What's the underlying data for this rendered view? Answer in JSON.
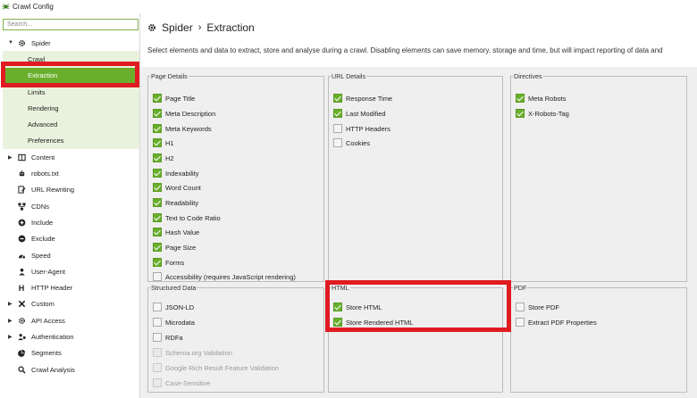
{
  "window": {
    "title": "Crawl Config"
  },
  "sidebar": {
    "search_placeholder": "Search...",
    "items": [
      {
        "label": "Spider",
        "icon": "gear-icon",
        "level": 1,
        "caret": "expanded"
      },
      {
        "label": "Crawl",
        "level": 2
      },
      {
        "label": "Extraction",
        "level": 2,
        "selected": true
      },
      {
        "label": "Limits",
        "level": 2
      },
      {
        "label": "Rendering",
        "level": 2
      },
      {
        "label": "Advanced",
        "level": 2
      },
      {
        "label": "Preferences",
        "level": 2,
        "highlight": true
      },
      {
        "label": "Content",
        "icon": "content-icon",
        "level": 1,
        "caret": "collapsed"
      },
      {
        "label": "robots.txt",
        "icon": "robot-icon",
        "level": 1
      },
      {
        "label": "URL Rewriting",
        "icon": "rewrite-icon",
        "level": 1
      },
      {
        "label": "CDNs",
        "icon": "cdn-icon",
        "level": 1
      },
      {
        "label": "Include",
        "icon": "include-icon",
        "level": 1
      },
      {
        "label": "Exclude",
        "icon": "exclude-icon",
        "level": 1
      },
      {
        "label": "Speed",
        "icon": "speed-icon",
        "level": 1
      },
      {
        "label": "User-Agent",
        "icon": "user-agent-icon",
        "level": 1
      },
      {
        "label": "HTTP Header",
        "icon": "http-header-icon",
        "level": 1
      },
      {
        "label": "Custom",
        "icon": "custom-icon",
        "level": 1,
        "caret": "collapsed"
      },
      {
        "label": "API Access",
        "icon": "api-icon",
        "level": 1,
        "caret": "collapsed"
      },
      {
        "label": "Authentication",
        "icon": "auth-icon",
        "level": 1,
        "caret": "collapsed"
      },
      {
        "label": "Segments",
        "icon": "segments-icon",
        "level": 1
      },
      {
        "label": "Crawl Analysis",
        "icon": "search-icon",
        "level": 1
      }
    ]
  },
  "main": {
    "breadcrumb": {
      "section": "Spider",
      "separator": "›",
      "page": "Extraction"
    },
    "description": "Select elements and data to extract, store and analyse during a crawl. Disabling elements can save memory, storage and time, but will impact reporting of data and",
    "groups": {
      "page_details": {
        "legend": "Page Details",
        "options": [
          {
            "label": "Page Title",
            "checked": true
          },
          {
            "label": "Meta Description",
            "checked": true
          },
          {
            "label": "Meta Keywords",
            "checked": true
          },
          {
            "label": "H1",
            "checked": true
          },
          {
            "label": "H2",
            "checked": true
          },
          {
            "label": "Indexability",
            "checked": true
          },
          {
            "label": "Word Count",
            "checked": true
          },
          {
            "label": "Readability",
            "checked": true
          },
          {
            "label": "Text to Code Ratio",
            "checked": true
          },
          {
            "label": "Hash Value",
            "checked": true
          },
          {
            "label": "Page Size",
            "checked": true
          },
          {
            "label": "Forms",
            "checked": true
          },
          {
            "label": "Accessibility (requires JavaScript rendering)",
            "checked": false
          }
        ]
      },
      "url_details": {
        "legend": "URL Details",
        "options": [
          {
            "label": "Response Time",
            "checked": true
          },
          {
            "label": "Last Modified",
            "checked": true
          },
          {
            "label": "HTTP Headers",
            "checked": false
          },
          {
            "label": "Cookies",
            "checked": false
          }
        ]
      },
      "directives": {
        "legend": "Directives",
        "options": [
          {
            "label": "Meta Robots",
            "checked": true
          },
          {
            "label": "X-Robots-Tag",
            "checked": true
          }
        ]
      },
      "structured_data": {
        "legend": "Structured Data",
        "options": [
          {
            "label": "JSON-LD",
            "checked": false
          },
          {
            "label": "Microdata",
            "checked": false
          },
          {
            "label": "RDFa",
            "checked": false
          },
          {
            "label": "Schema.org Validation",
            "checked": false,
            "disabled": true
          },
          {
            "label": "Google Rich Result Feature Validation",
            "checked": false,
            "disabled": true
          },
          {
            "label": "Case-Sensitive",
            "checked": false,
            "disabled": true
          }
        ]
      },
      "html": {
        "legend": "HTML",
        "options": [
          {
            "label": "Store HTML",
            "checked": true
          },
          {
            "label": "Store Rendered HTML",
            "checked": true
          }
        ]
      },
      "pdf": {
        "legend": "PDF",
        "options": [
          {
            "label": "Store PDF",
            "checked": false
          },
          {
            "label": "Extract PDF Properties",
            "checked": false
          }
        ]
      }
    }
  },
  "colors": {
    "accent": "#6aaf2c",
    "highlight_box": "#e01b22",
    "submenu_bg": "#e9f2dd"
  }
}
